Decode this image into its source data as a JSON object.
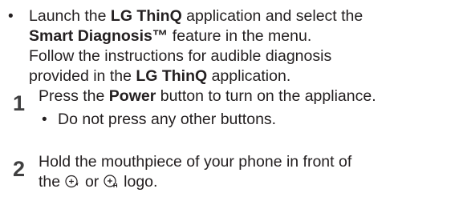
{
  "intro_bullet": {
    "line1_a": "Launch the ",
    "line1_b": "LG ThinQ",
    "line1_c": " application and select the",
    "line2_a": "Smart Diagnosis™",
    "line2_b": " feature in the menu.",
    "line3": "Follow the instructions for audible diagnosis",
    "line4_a": "provided in the ",
    "line4_b": "LG ThinQ",
    "line4_c": " application."
  },
  "steps": [
    {
      "number": "1",
      "text_a": "Press the ",
      "text_b": "Power",
      "text_c": " button to turn on the appliance.",
      "sub_bullet": "Do not press any other buttons."
    },
    {
      "number": "2",
      "line1": "Hold the mouthpiece of your phone in front of",
      "line2_a": "the ",
      "line2_b": " or ",
      "line2_c": " logo.",
      "logo_icons": [
        "smart-diagnosis-logo-icon",
        "smart-diagnosis-alt-logo-icon"
      ]
    }
  ],
  "bullet_glyph": "•"
}
